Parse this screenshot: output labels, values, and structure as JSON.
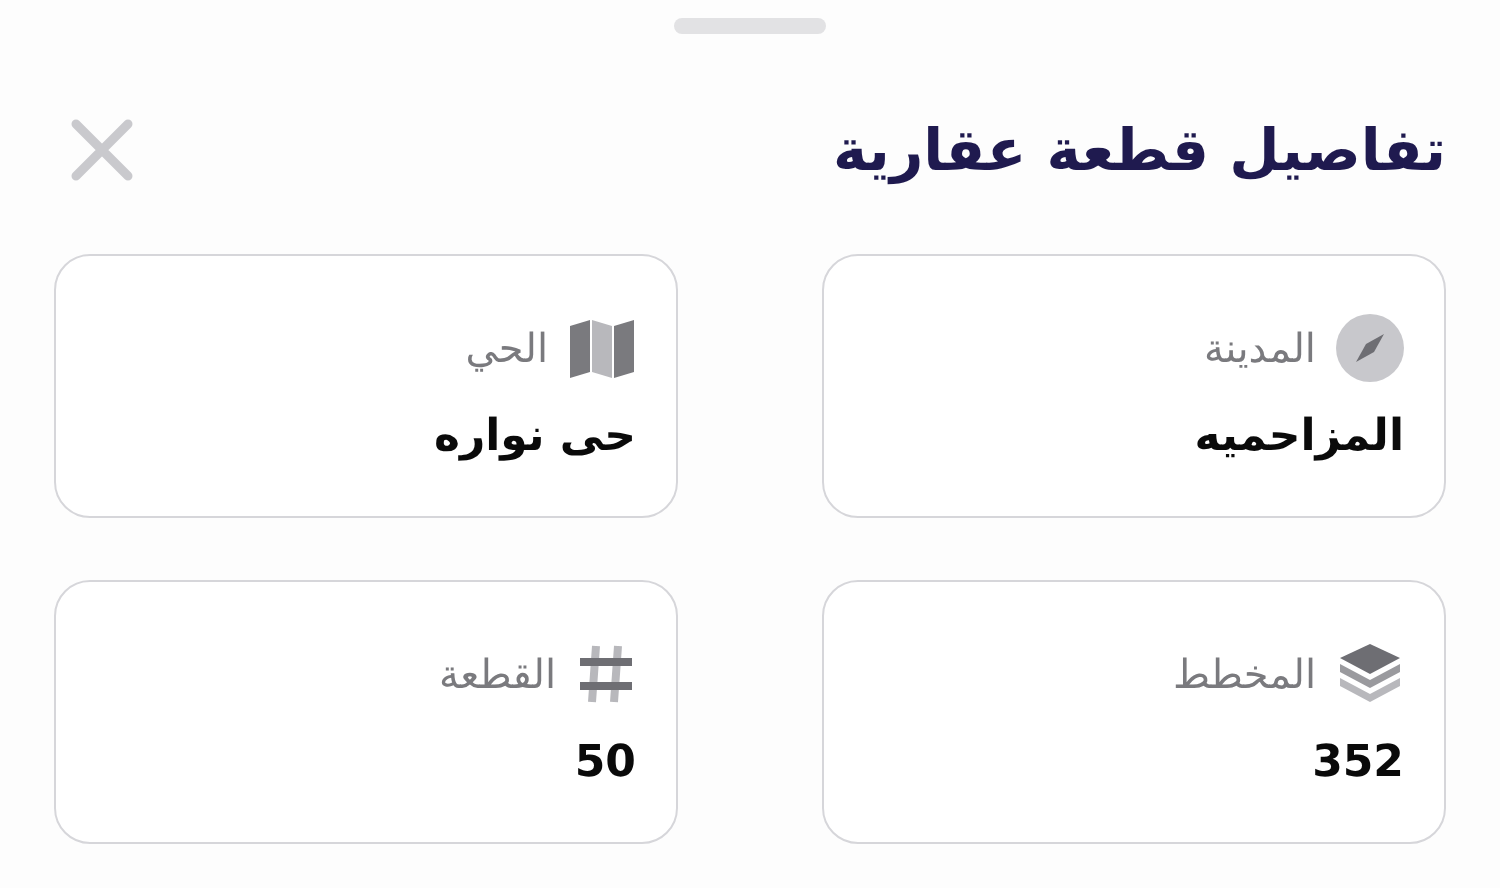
{
  "sheet": {
    "title": "تفاصيل قطعة عقارية"
  },
  "fields": [
    {
      "kind": "compass",
      "label": "المدينة",
      "value": "المزاحميه"
    },
    {
      "kind": "map",
      "label": "الحي",
      "value": "حى نواره"
    },
    {
      "kind": "layers",
      "label": "المخطط",
      "value": "352"
    },
    {
      "kind": "hash",
      "label": "القطعة",
      "value": "50"
    }
  ]
}
